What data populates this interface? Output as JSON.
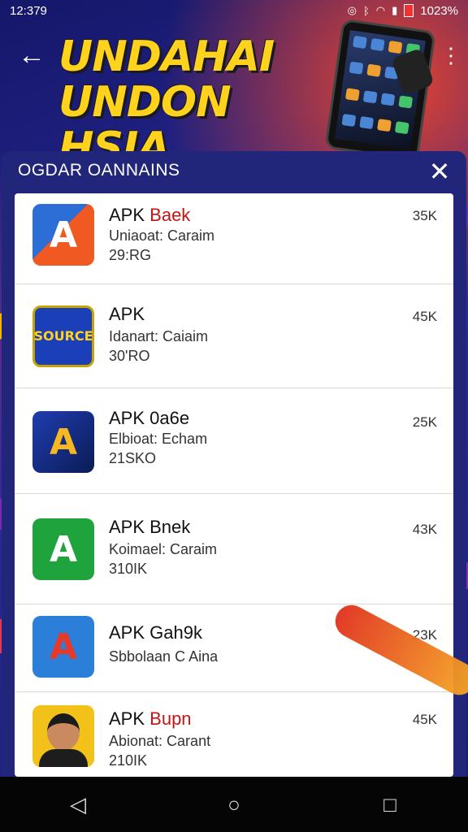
{
  "status_bar": {
    "time": "12:379",
    "battery_text": "1023%"
  },
  "header": {
    "title_line1": "UNDAHAI",
    "title_line2": "UNDON HSIA"
  },
  "panel": {
    "heading": "OGDAR OANNAINS"
  },
  "apps": [
    {
      "name_main": "APK",
      "name_accent": "Baek",
      "subtitle": "Uniaoat: Caraim",
      "meta": "29:RG",
      "size": "35K"
    },
    {
      "name_main": "APK",
      "name_accent": "",
      "subtitle": "Idanart: Caiaim",
      "meta": "30'RO",
      "size": "45K"
    },
    {
      "name_main": "APK 0a6e",
      "name_accent": "",
      "subtitle": "Elbioat: Echam",
      "meta": "21SKO",
      "size": "25K"
    },
    {
      "name_main": "APK Bnek",
      "name_accent": "",
      "subtitle": "Koimael: Caraim",
      "meta": "310IK",
      "size": "43K"
    },
    {
      "name_main": "APK Gah9k",
      "name_accent": "",
      "subtitle": "Sbbolaan C Aina",
      "meta": "",
      "size": "23K"
    },
    {
      "name_main": "APK",
      "name_accent": "Bupn",
      "subtitle": "Abionat: Carant",
      "meta": "210IK",
      "size": "45K"
    }
  ],
  "icons": {
    "back": "arrow-left-icon",
    "more": "more-vertical-icon",
    "close": "close-icon",
    "nav_back": "triangle-back-icon",
    "nav_home": "circle-home-icon",
    "nav_recent": "square-recent-icon"
  },
  "colors": {
    "title": "#ffd21e",
    "accent": "#c41515",
    "panel": "#22267a"
  }
}
